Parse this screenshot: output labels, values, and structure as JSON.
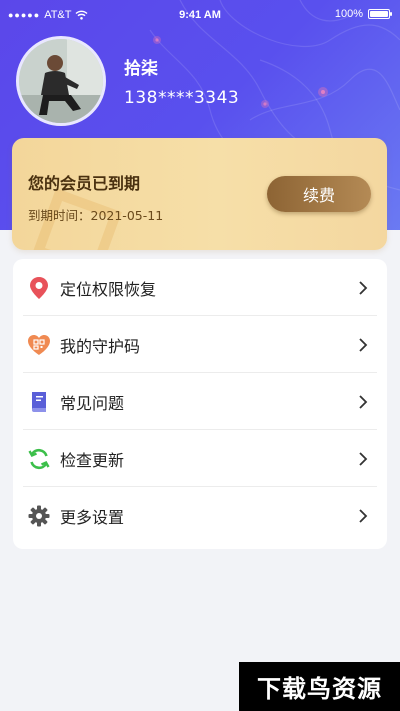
{
  "status_bar": {
    "carrier": "AT&T",
    "time": "9:41 AM",
    "battery": "100%"
  },
  "profile": {
    "name": "拾柒",
    "phone": "138****3343"
  },
  "membership": {
    "title": "您的会员已到期",
    "expire_label": "到期时间：2021-05-11",
    "renew_label": "续费"
  },
  "menu": {
    "items": [
      {
        "label": "定位权限恢复",
        "icon": "location-pin-icon"
      },
      {
        "label": "我的守护码",
        "icon": "heart-qr-icon"
      },
      {
        "label": "常见问题",
        "icon": "book-icon"
      },
      {
        "label": "检查更新",
        "icon": "refresh-icon"
      },
      {
        "label": "更多设置",
        "icon": "gear-icon"
      }
    ]
  },
  "watermark": "下载鸟资源",
  "colors": {
    "header": "#5b47ea",
    "card_gold": "#f3d69a",
    "renew_button": "#8d6434"
  }
}
